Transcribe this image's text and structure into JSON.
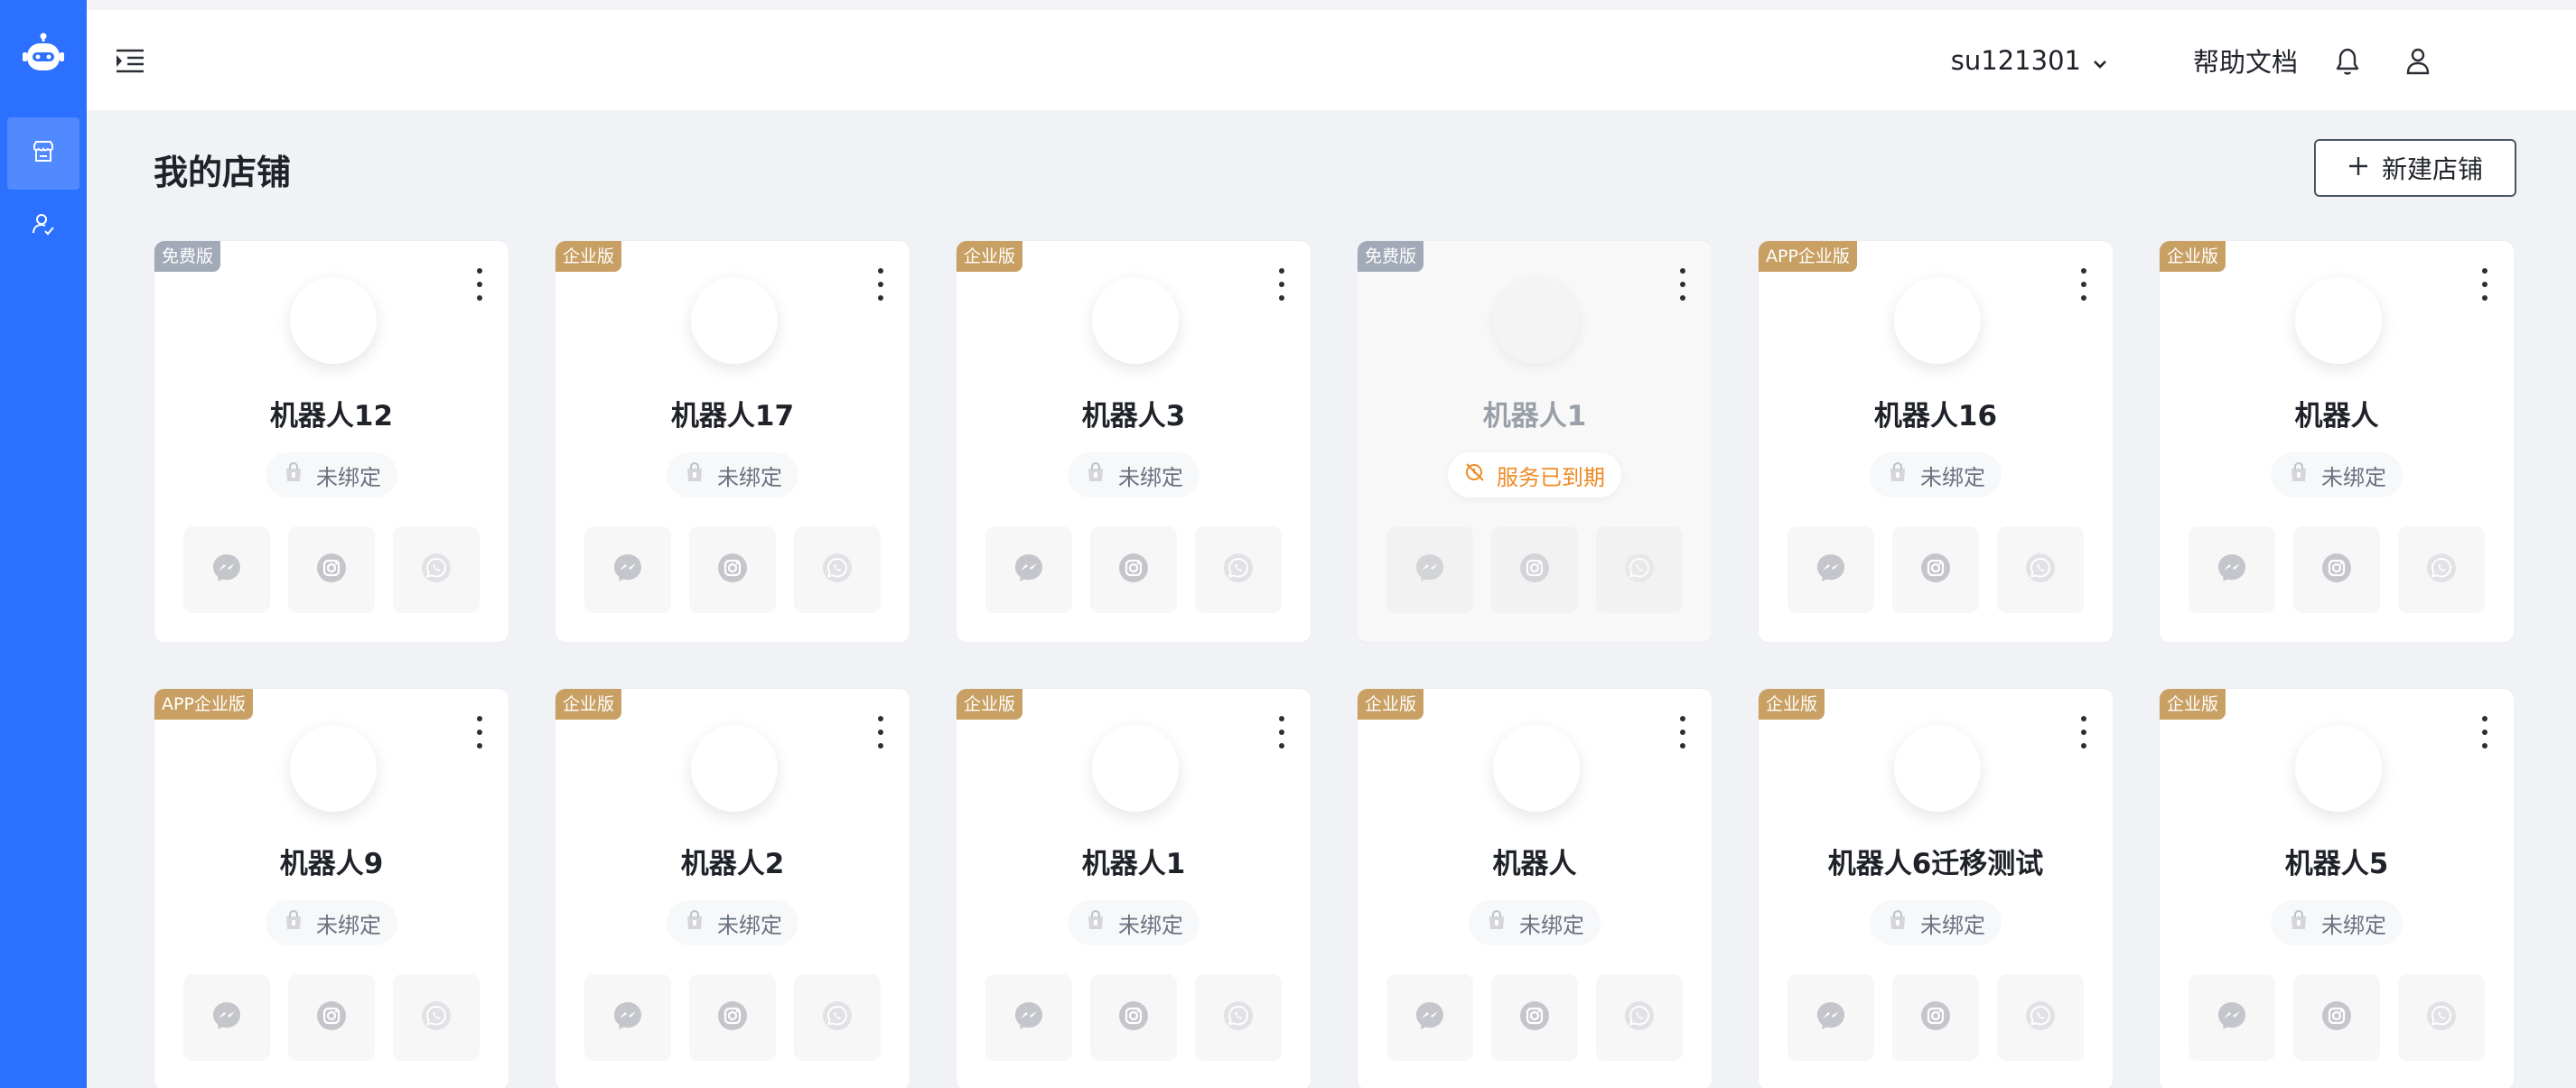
{
  "header": {
    "username": "su121301",
    "help_label": "帮助文档"
  },
  "page": {
    "title": "我的店铺",
    "new_store_label": "新建店铺"
  },
  "colors": {
    "sidebar": "#2b70ff",
    "badge_paid": "#c9a063",
    "badge_free": "#a3aab7",
    "expired_text": "#f08a24"
  },
  "icons": [
    "robot-logo-icon",
    "store-icon",
    "user-check-icon",
    "menu-toggle-icon",
    "chevron-down-icon",
    "bell-icon",
    "user-icon",
    "plus-icon",
    "more-vertical-icon",
    "shopping-bag-icon",
    "messenger-icon",
    "instagram-icon",
    "whatsapp-icon",
    "expired-icon"
  ],
  "cards": [
    {
      "badge": "免费版",
      "tier": "free",
      "name": "机器人12",
      "status": "未绑定",
      "expired": false
    },
    {
      "badge": "企业版",
      "tier": "paid",
      "name": "机器人17",
      "status": "未绑定",
      "expired": false
    },
    {
      "badge": "企业版",
      "tier": "paid",
      "name": "机器人3",
      "status": "未绑定",
      "expired": false
    },
    {
      "badge": "免费版",
      "tier": "free",
      "name": "机器人1",
      "status": "服务已到期",
      "expired": true
    },
    {
      "badge": "APP企业版",
      "tier": "paid",
      "name": "机器人16",
      "status": "未绑定",
      "expired": false
    },
    {
      "badge": "企业版",
      "tier": "paid",
      "name": "机器人",
      "status": "未绑定",
      "expired": false
    },
    {
      "badge": "APP企业版",
      "tier": "paid",
      "name": "机器人9",
      "status": "未绑定",
      "expired": false
    },
    {
      "badge": "企业版",
      "tier": "paid",
      "name": "机器人2",
      "status": "未绑定",
      "expired": false
    },
    {
      "badge": "企业版",
      "tier": "paid",
      "name": "机器人1",
      "status": "未绑定",
      "expired": false
    },
    {
      "badge": "企业版",
      "tier": "paid",
      "name": "机器人",
      "status": "未绑定",
      "expired": false
    },
    {
      "badge": "企业版",
      "tier": "paid",
      "name": "机器人6迁移测试",
      "status": "未绑定",
      "expired": false
    },
    {
      "badge": "企业版",
      "tier": "paid",
      "name": "机器人5",
      "status": "未绑定",
      "expired": false
    }
  ]
}
